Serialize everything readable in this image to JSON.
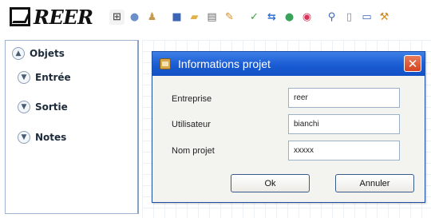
{
  "app": {
    "logo_text": "REER"
  },
  "toolbar": {
    "icons": [
      {
        "name": "new-page-icon",
        "glyph": "⊞",
        "color": "#555555",
        "bg": "#f3f3f3"
      },
      {
        "name": "open-plan-icon",
        "glyph": "●",
        "color": "#6c8fc7",
        "bg": "#ffffff"
      },
      {
        "name": "user-icon",
        "glyph": "♟",
        "color": "#c79a4b",
        "bg": "#ffffff"
      },
      {
        "name": "save-icon",
        "glyph": "■",
        "color": "#3b66b5",
        "bg": "#ffffff"
      },
      {
        "name": "open-folder-icon",
        "glyph": "▰",
        "color": "#e0b34a",
        "bg": "#ffffff"
      },
      {
        "name": "print-icon",
        "glyph": "▤",
        "color": "#6a6a6a",
        "bg": "#ffffff"
      },
      {
        "name": "edit-icon",
        "glyph": "✎",
        "color": "#d88a1d",
        "bg": "#ffffff"
      },
      {
        "name": "validate-icon",
        "glyph": "✓",
        "color": "#3aa33a",
        "bg": "#ffffff"
      },
      {
        "name": "sync-icon",
        "glyph": "⇆",
        "color": "#2f6fd0",
        "bg": "#ffffff"
      },
      {
        "name": "connect-icon",
        "glyph": "●",
        "color": "#3aa35a",
        "bg": "#ffffff"
      },
      {
        "name": "stop-icon",
        "glyph": "◉",
        "color": "#d6335a",
        "bg": "#ffffff"
      },
      {
        "name": "zoom-icon",
        "glyph": "⚲",
        "color": "#3b66b5",
        "bg": "#ffffff"
      },
      {
        "name": "document-icon",
        "glyph": "▯",
        "color": "#7a8fb0",
        "bg": "#ffffff"
      },
      {
        "name": "monitor-icon",
        "glyph": "▭",
        "color": "#3b66b5",
        "bg": "#ffffff"
      },
      {
        "name": "tools-icon",
        "glyph": "⚒",
        "color": "#d08a1d",
        "bg": "#ffffff"
      }
    ]
  },
  "sidebar": {
    "items": [
      {
        "label": "Objets",
        "chevron": "up"
      },
      {
        "label": "Entrée",
        "chevron": "down"
      },
      {
        "label": "Sortie",
        "chevron": "down"
      },
      {
        "label": "Notes",
        "chevron": "down"
      }
    ]
  },
  "dialog": {
    "title": "Informations projet",
    "close_label": "✕",
    "fields": [
      {
        "label": "Entreprise",
        "value": "reer"
      },
      {
        "label": "Utilisateur",
        "value": "bianchi"
      },
      {
        "label": "Nom projet",
        "value": "xxxxx"
      }
    ],
    "ok_label": "Ok",
    "cancel_label": "Annuler"
  },
  "colors": {
    "titlebar": "#1a5cd3",
    "close_button": "#d4421f",
    "dialog_bg": "#f3f3ef",
    "panel_border": "#9db3cf"
  }
}
